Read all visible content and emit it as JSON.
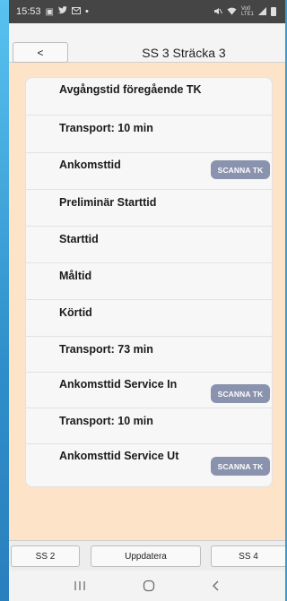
{
  "status_bar": {
    "time": "15:53",
    "dot": "•",
    "signal_text": "Vo0 LTE1"
  },
  "header": {
    "back_label": "<",
    "title": "SS 3 Sträcka 3"
  },
  "rows": [
    {
      "label": "Avgångstid föregående TK",
      "has_scan": false
    },
    {
      "label": "Transport: 10 min",
      "has_scan": false
    },
    {
      "label": "Ankomsttid",
      "has_scan": true
    },
    {
      "label": "Preliminär Starttid",
      "has_scan": false
    },
    {
      "label": "Starttid",
      "has_scan": false
    },
    {
      "label": "Måltid",
      "has_scan": false
    },
    {
      "label": "Körtid",
      "has_scan": false
    },
    {
      "label": "Transport: 73 min",
      "has_scan": false
    },
    {
      "label": "Ankomsttid Service In",
      "has_scan": true
    },
    {
      "label": "Transport: 10 min",
      "has_scan": false
    },
    {
      "label": "Ankomsttid Service Ut",
      "has_scan": true
    }
  ],
  "scan_label": "SCANNA TK",
  "bottom": {
    "prev_label": "SS 2",
    "update_label": "Uppdatera",
    "next_label": "SS 4"
  },
  "nav": {
    "recent_icon": "recent-apps-icon",
    "home_icon": "home-icon",
    "back_icon": "back-icon"
  },
  "colors": {
    "background": "#fde3c8",
    "scan_button": "#8a93ad",
    "status_bar": "#454545"
  }
}
